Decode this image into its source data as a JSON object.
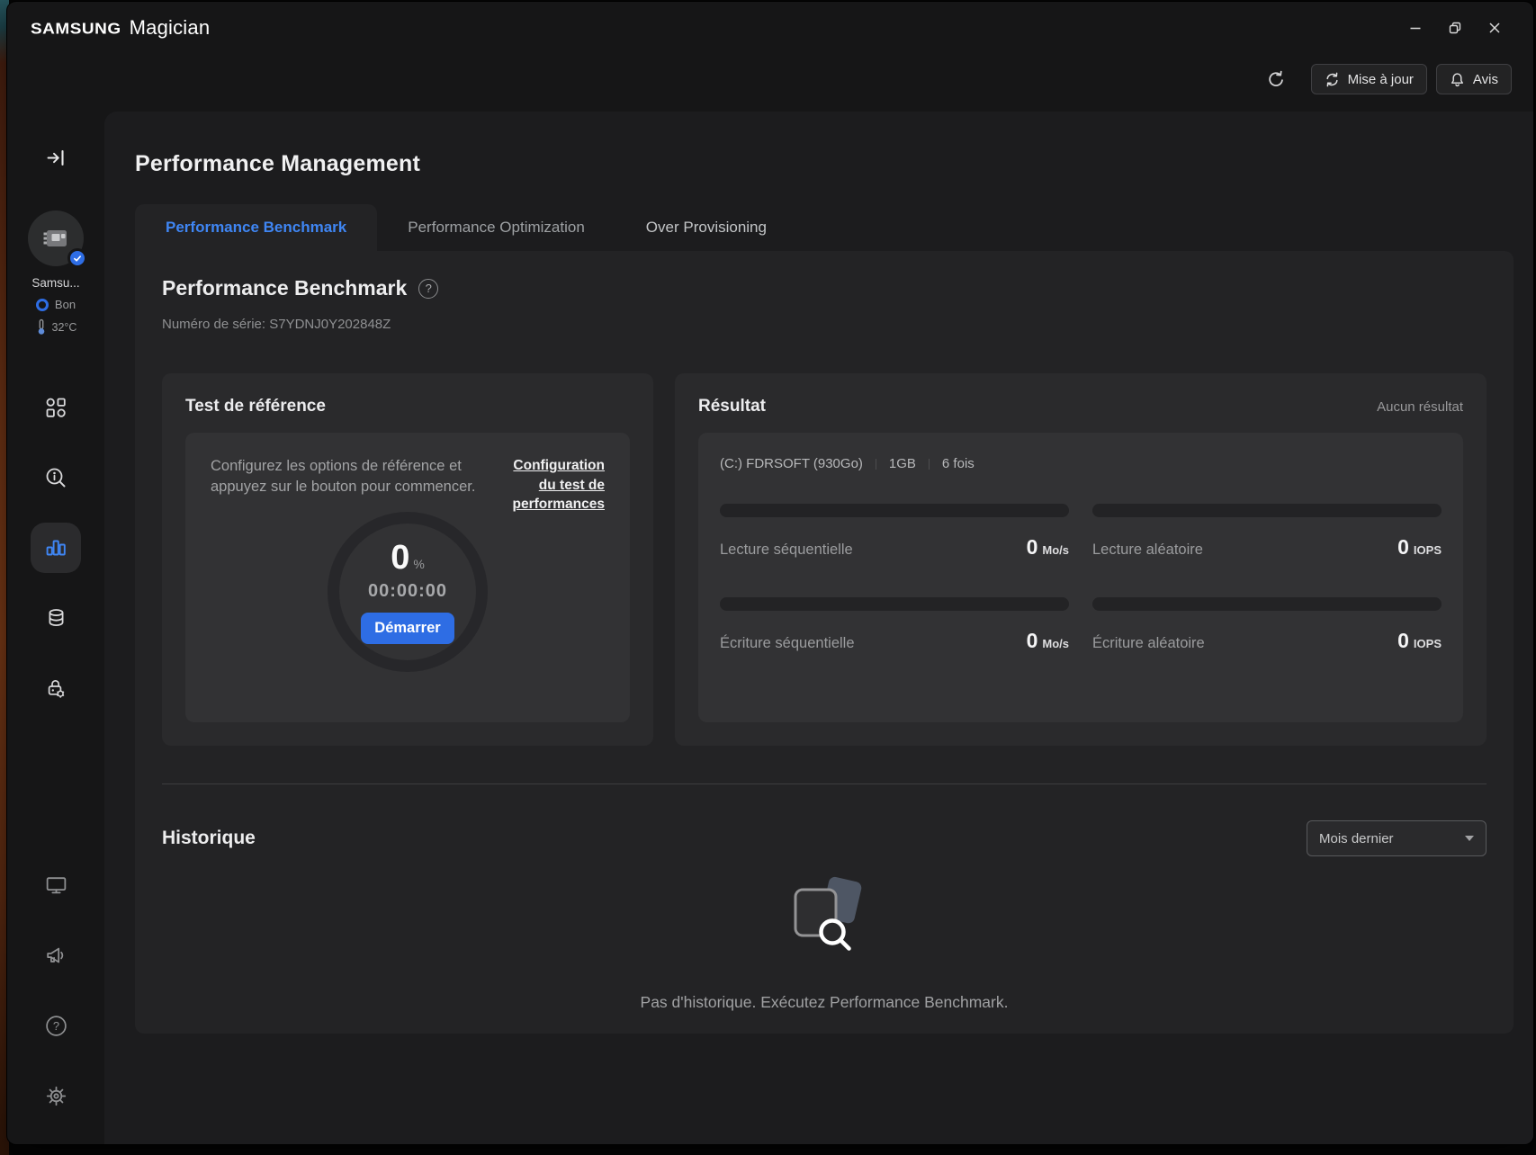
{
  "window": {
    "brand": "SAMSUNG",
    "app": "Magician",
    "controls": [
      "minimize",
      "restore",
      "close"
    ]
  },
  "header": {
    "refresh_icon": "refresh-icon",
    "update_label": "Mise à jour",
    "update_icon": "sync-icon",
    "notice_label": "Avis",
    "notice_icon": "bell-icon"
  },
  "sidebar": {
    "collapse_icon": "expand-panel-icon",
    "drive_name": "Samsu...",
    "health_label": "Bon",
    "temperature": "32°C",
    "nav_items": [
      {
        "name": "dashboard",
        "icon": "apps-grid-icon",
        "active": false
      },
      {
        "name": "drive-details",
        "icon": "search-info-icon",
        "active": false
      },
      {
        "name": "performance-management",
        "icon": "bar-chart-icon",
        "active": true
      },
      {
        "name": "data-management",
        "icon": "database-icon",
        "active": false
      },
      {
        "name": "security",
        "icon": "lock-gear-icon",
        "active": false
      }
    ],
    "footer_items": [
      {
        "name": "system-compatibility",
        "icon": "monitor-icon"
      },
      {
        "name": "announcements",
        "icon": "megaphone-icon"
      },
      {
        "name": "help",
        "icon": "help-icon"
      },
      {
        "name": "settings",
        "icon": "gear-icon"
      }
    ]
  },
  "page": {
    "title": "Performance Management",
    "tabs": [
      {
        "label": "Performance Benchmark",
        "active": true
      },
      {
        "label": "Performance Optimization",
        "active": false
      },
      {
        "label": "Over Provisioning",
        "active": false
      }
    ],
    "section_title": "Performance Benchmark",
    "help_glyph": "?",
    "serial": "Numéro de série: S7YDNJ0Y202848Z"
  },
  "benchmark": {
    "card_title": "Test de référence",
    "instructions": "Configurez les options de référence et appuyez sur le bouton pour commencer.",
    "config_link": "Configuration du test de performances",
    "progress_value": "0",
    "progress_unit": "%",
    "elapsed": "00:00:00",
    "start_label": "Démarrer"
  },
  "result": {
    "card_title": "Résultat",
    "empty_label": "Aucun résultat",
    "drive_label": "(C:) FDRSOFT (930Go)",
    "size_label": "1GB",
    "runs_label": "6 fois",
    "metrics": [
      {
        "label": "Lecture séquentielle",
        "value": "0",
        "unit": "Mo/s"
      },
      {
        "label": "Lecture aléatoire",
        "value": "0",
        "unit": "IOPS"
      },
      {
        "label": "Écriture séquentielle",
        "value": "0",
        "unit": "Mo/s"
      },
      {
        "label": "Écriture aléatoire",
        "value": "0",
        "unit": "IOPS"
      }
    ]
  },
  "history": {
    "title": "Historique",
    "filter_value": "Mois dernier",
    "empty_message": "Pas d'historique. Exécutez Performance Benchmark."
  },
  "colors": {
    "accent_blue": "#2e6de4",
    "tab_active_blue": "#3f86f4",
    "panel_bg": "#232325",
    "card_bg": "#2a2a2c",
    "inner_card_bg": "#323234",
    "window_bg": "#161617",
    "main_bg": "#1c1c1e"
  }
}
